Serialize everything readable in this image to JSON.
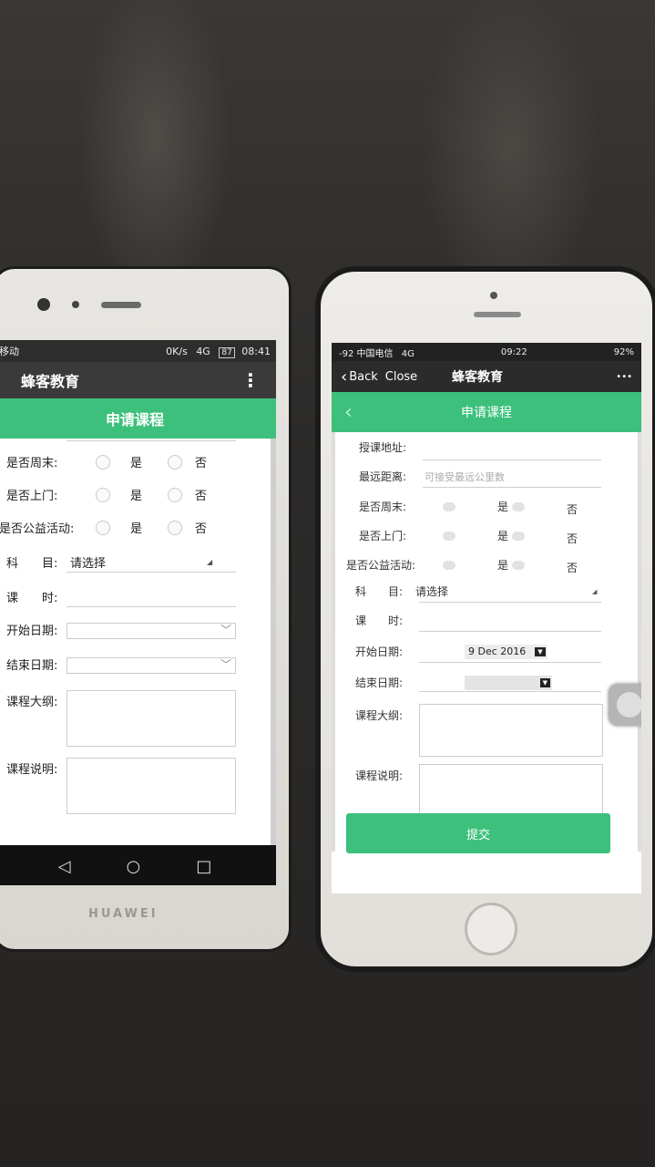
{
  "android": {
    "brand": "HUAWEI",
    "status": {
      "carrier": "移动",
      "network": "0K/s",
      "signal": "4G",
      "battery": "87",
      "time": "08:41"
    },
    "app_title": "蜂客教育",
    "menu_icon": "more-vert-icon",
    "page_title": "申请课程",
    "radio_rows": [
      {
        "label": "是否周末:",
        "yes": "是",
        "no": "否"
      },
      {
        "label": "是否上门:",
        "yes": "是",
        "no": "否"
      },
      {
        "label": "是否公益活动:",
        "yes": "是",
        "no": "否"
      }
    ],
    "subject_label": "科　　目:",
    "subject_value": "请选择",
    "hours_label": "课　　时:",
    "start_date_label": "开始日期:",
    "end_date_label": "结束日期:",
    "outline_label": "课程大纲:",
    "description_label": "课程说明:"
  },
  "iphone": {
    "status": {
      "signal": "-92 中国电信",
      "network": "4G",
      "time": "09:22",
      "battery": "92%"
    },
    "nav": {
      "back": "Back",
      "close": "Close",
      "title": "蜂客教育",
      "more": "•••"
    },
    "page_title": "申请课程",
    "address_label": "授课地址:",
    "distance_label": "最远距离:",
    "distance_placeholder": "可接受最远公里数",
    "radio_rows": [
      {
        "label": "是否周末:",
        "yes": "是",
        "no": "否"
      },
      {
        "label": "是否上门:",
        "yes": "是",
        "no": "否"
      },
      {
        "label": "是否公益活动:",
        "yes": "是",
        "no": "否"
      }
    ],
    "subject_label": "科　　目:",
    "subject_value": "请选择",
    "hours_label": "课　　时:",
    "start_date_label": "开始日期:",
    "start_date_value": "9 Dec 2016",
    "end_date_label": "结束日期:",
    "outline_label": "课程大纲:",
    "description_label": "课程说明:",
    "submit_label": "提交"
  }
}
